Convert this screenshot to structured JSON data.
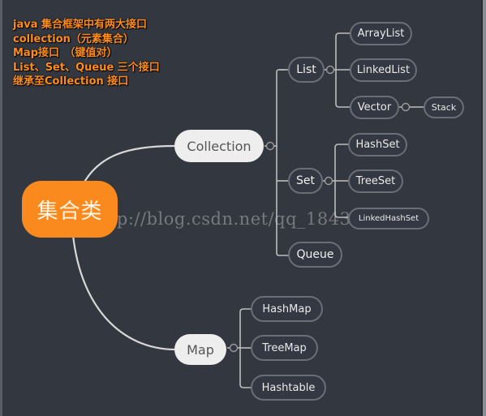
{
  "notes": [
    "java 集合框架中有两大接口",
    "collection（元素集合）",
    "Map接口　（键值对）",
    "List、Set、Queue 三个接口",
    "继承至Collection 接口"
  ],
  "colors": {
    "background": "#333740",
    "root_fill": "#fb8a1e",
    "note_text": "#ff8c1a",
    "connector": "#e0e0e0",
    "main_node_fill": "#eeeeee"
  },
  "mindmap": {
    "root": "集合类",
    "collection": {
      "label": "Collection",
      "children": {
        "list": {
          "label": "List",
          "children": [
            "ArrayList",
            "LinkedList",
            "Vector"
          ],
          "vector_child": "Stack"
        },
        "set": {
          "label": "Set",
          "children": [
            "HashSet",
            "TreeSet",
            "LinkedHashSet"
          ]
        },
        "queue": {
          "label": "Queue"
        }
      }
    },
    "map": {
      "label": "Map",
      "children": [
        "HashMap",
        "TreeMap",
        "Hashtable"
      ]
    }
  },
  "watermark": "http://blog.csdn.net/qq_18433441"
}
